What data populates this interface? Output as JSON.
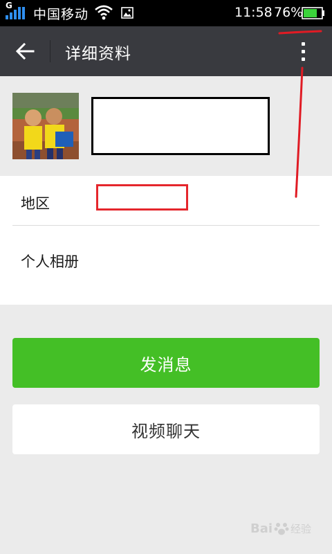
{
  "status_bar": {
    "network_type": "G",
    "carrier": "中国移动",
    "time": "11:58",
    "battery_percent": "76%",
    "battery_level": 0.76,
    "battery_color": "#3bd33b",
    "signal_color": "#2f8ff0"
  },
  "action_bar": {
    "back_icon": "arrow-left-icon",
    "title": "详细资料",
    "more_icon": "more-vertical-icon",
    "background": "#393a3f"
  },
  "profile": {
    "avatar_alt": "avatar photo",
    "name_redacted": true
  },
  "info": {
    "region_label": "地区",
    "album_label": "个人相册"
  },
  "actions": {
    "send_message": "发消息",
    "video_chat": "视频聊天",
    "send_color": "#44bf26"
  },
  "watermark": {
    "brand": "Bai",
    "brand_tail": "经验"
  }
}
